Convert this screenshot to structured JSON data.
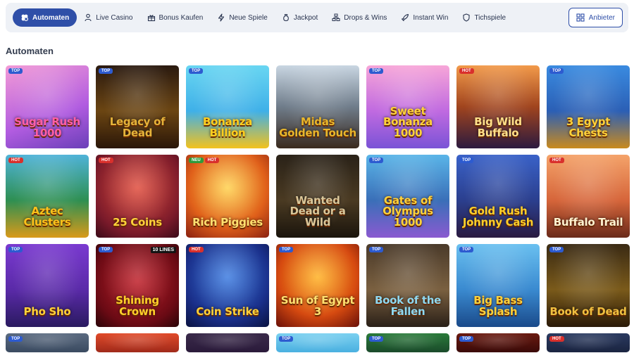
{
  "nav": {
    "items": [
      {
        "label": "Automaten",
        "icon": "clover-icon",
        "active": true
      },
      {
        "label": "Live Casino",
        "icon": "dealer-icon",
        "active": false
      },
      {
        "label": "Bonus Kaufen",
        "icon": "gift-icon",
        "active": false
      },
      {
        "label": "Neue Spiele",
        "icon": "lightning-icon",
        "active": false
      },
      {
        "label": "Jackpot",
        "icon": "moneybag-icon",
        "active": false
      },
      {
        "label": "Drops & Wins",
        "icon": "drops-icon",
        "active": false
      },
      {
        "label": "Instant Win",
        "icon": "rocket-icon",
        "active": false
      },
      {
        "label": "Tichspiele",
        "icon": "shield-icon",
        "active": false
      }
    ],
    "provider_label": "Anbieter"
  },
  "section": {
    "title": "Automaten"
  },
  "colors": {
    "accent": "#2f4fa8",
    "top_badge": "#2d5bd0",
    "hot_badge": "#d9302c",
    "new_badge": "#2e9b3c"
  },
  "games": [
    {
      "name": "Sugar Rush 1000",
      "badges": [
        "TOP"
      ],
      "bg": "linear-gradient(160deg,#f39bd6,#b15ce0 60%,#6a3fb8)",
      "color": "#ff5fa8"
    },
    {
      "name": "Legacy of Dead",
      "badges": [
        "TOP"
      ],
      "bg": "linear-gradient(180deg,#2a1a10,#6b4512 55%,#2a1608)",
      "color": "#e5b33a"
    },
    {
      "name": "Bonanza Billion",
      "badges": [
        "TOP"
      ],
      "bg": "linear-gradient(180deg,#69d6f2,#3fb0e8 55%,#f3c21d)",
      "color": "#ffcf1f"
    },
    {
      "name": "Midas Golden Touch",
      "badges": [],
      "bg": "linear-gradient(180deg,#c9d6e2,#6f7c8a 50%,#3a2a1e)",
      "color": "#e8b62c"
    },
    {
      "name": "Sweet Bonanza 1000",
      "badges": [
        "TOP"
      ],
      "bg": "linear-gradient(180deg,#f7a6d8,#c06ae0 55%,#7a53d6)",
      "color": "#ffd23a"
    },
    {
      "name": "Big Wild Buffalo",
      "badges": [
        "HOT"
      ],
      "bg": "linear-gradient(180deg,#f29a4a,#a0441e 50%,#2c1a3f)",
      "color": "#ffe08a"
    },
    {
      "name": "3 Egypt Chests",
      "badges": [
        "TOP"
      ],
      "bg": "linear-gradient(180deg,#3a8be0,#2b5fb5 55%,#c98a1e)",
      "color": "#ffd23a"
    },
    {
      "name": "Aztec Clusters",
      "badges": [
        "HOT"
      ],
      "bg": "linear-gradient(180deg,#4fb3d8,#2e8f52 55%,#d99a1a)",
      "color": "#ffc21a"
    },
    {
      "name": "25 Coins",
      "badges": [
        "HOT"
      ],
      "bg": "radial-gradient(circle at 50% 40%,#e04a3a,#7a1a2a 70%,#3a0a18)",
      "color": "#ffd23a"
    },
    {
      "name": "Rich Piggies",
      "badges": [
        "NEU",
        "HOT"
      ],
      "bg": "radial-gradient(circle at 50% 40%,#ffd04a,#e0601a 60%,#8a2010)",
      "color": "#ffe070"
    },
    {
      "name": "Wanted Dead or a Wild",
      "badges": [],
      "bg": "linear-gradient(180deg,#2a2218,#4a3a22 55%,#1a140c)",
      "color": "#d9c79a"
    },
    {
      "name": "Gates of Olympus 1000",
      "badges": [
        "TOP"
      ],
      "bg": "linear-gradient(180deg,#5ab5e8,#3a6fb8 55%,#8a5ad0)",
      "color": "#ffd23a"
    },
    {
      "name": "Gold Rush Johnny Cash",
      "badges": [
        "TOP"
      ],
      "bg": "linear-gradient(180deg,#3a62c8,#2b3f8e 55%,#2a1a40)",
      "color": "#ffcf2a"
    },
    {
      "name": "Buffalo Trail",
      "badges": [
        "HOT"
      ],
      "bg": "linear-gradient(180deg,#f4a36a,#d6653a 55%,#6a2a1a)",
      "color": "#fff2d0"
    },
    {
      "name": "Pho Sho",
      "badges": [
        "TOP"
      ],
      "bg": "linear-gradient(180deg,#7a3ad0,#5a2aa8 55%,#2a1a60)",
      "color": "#ffd23a"
    },
    {
      "name": "Shining Crown",
      "badges": [
        "TOP"
      ],
      "corner": "10 LINES",
      "bg": "radial-gradient(circle at 50% 45%,#c0202a,#6a0a14 70%,#2a0408)",
      "color": "#ffcf2a"
    },
    {
      "name": "Coin Strike",
      "badges": [
        "HOT"
      ],
      "bg": "radial-gradient(circle at 50% 40%,#3a7ae0,#1a2f8a 65%,#0a1240)",
      "color": "#ffd23a"
    },
    {
      "name": "Sun of Egypt 3",
      "badges": [
        "TOP"
      ],
      "bg": "radial-gradient(circle at 50% 40%,#ffb020,#d64a10 60%,#6a1008)",
      "color": "#ffe070"
    },
    {
      "name": "Book of the Fallen",
      "badges": [
        "TOP"
      ],
      "bg": "linear-gradient(180deg,#4a3a2a,#7a6040 55%,#2a2018)",
      "color": "#8fd8f0"
    },
    {
      "name": "Big Bass Splash",
      "badges": [
        "TOP"
      ],
      "bg": "linear-gradient(180deg,#6ac0f0,#3a8ad0 55%,#1a4a8a)",
      "color": "#ffd23a"
    },
    {
      "name": "Book of Dead",
      "badges": [
        "TOP"
      ],
      "bg": "linear-gradient(180deg,#3a2a14,#7a5a1a 55%,#2a1a08)",
      "color": "#f0c040"
    },
    {
      "name": "",
      "badges": [
        "TOP"
      ],
      "bg": "linear-gradient(180deg,#5a6a80,#3a4a60)",
      "color": "#fff"
    },
    {
      "name": "",
      "badges": [],
      "bg": "linear-gradient(180deg,#e04a2a,#a02a1a)",
      "color": "#fff"
    },
    {
      "name": "",
      "badges": [],
      "bg": "linear-gradient(180deg,#3a2a4a,#2a1a3a)",
      "color": "#fff"
    },
    {
      "name": "",
      "badges": [
        "TOP"
      ],
      "bg": "linear-gradient(180deg,#7ad0f0,#4ab0e0)",
      "color": "#fff"
    },
    {
      "name": "",
      "badges": [
        "TOP"
      ],
      "bg": "linear-gradient(180deg,#2a7a3a,#1a4a2a)",
      "color": "#fff"
    },
    {
      "name": "",
      "badges": [
        "TOP"
      ],
      "bg": "linear-gradient(180deg,#6a1a10,#3a0a08)",
      "color": "#fff"
    },
    {
      "name": "",
      "badges": [
        "HOT"
      ],
      "bg": "linear-gradient(180deg,#2a3a60,#1a2440)",
      "color": "#fff"
    }
  ]
}
